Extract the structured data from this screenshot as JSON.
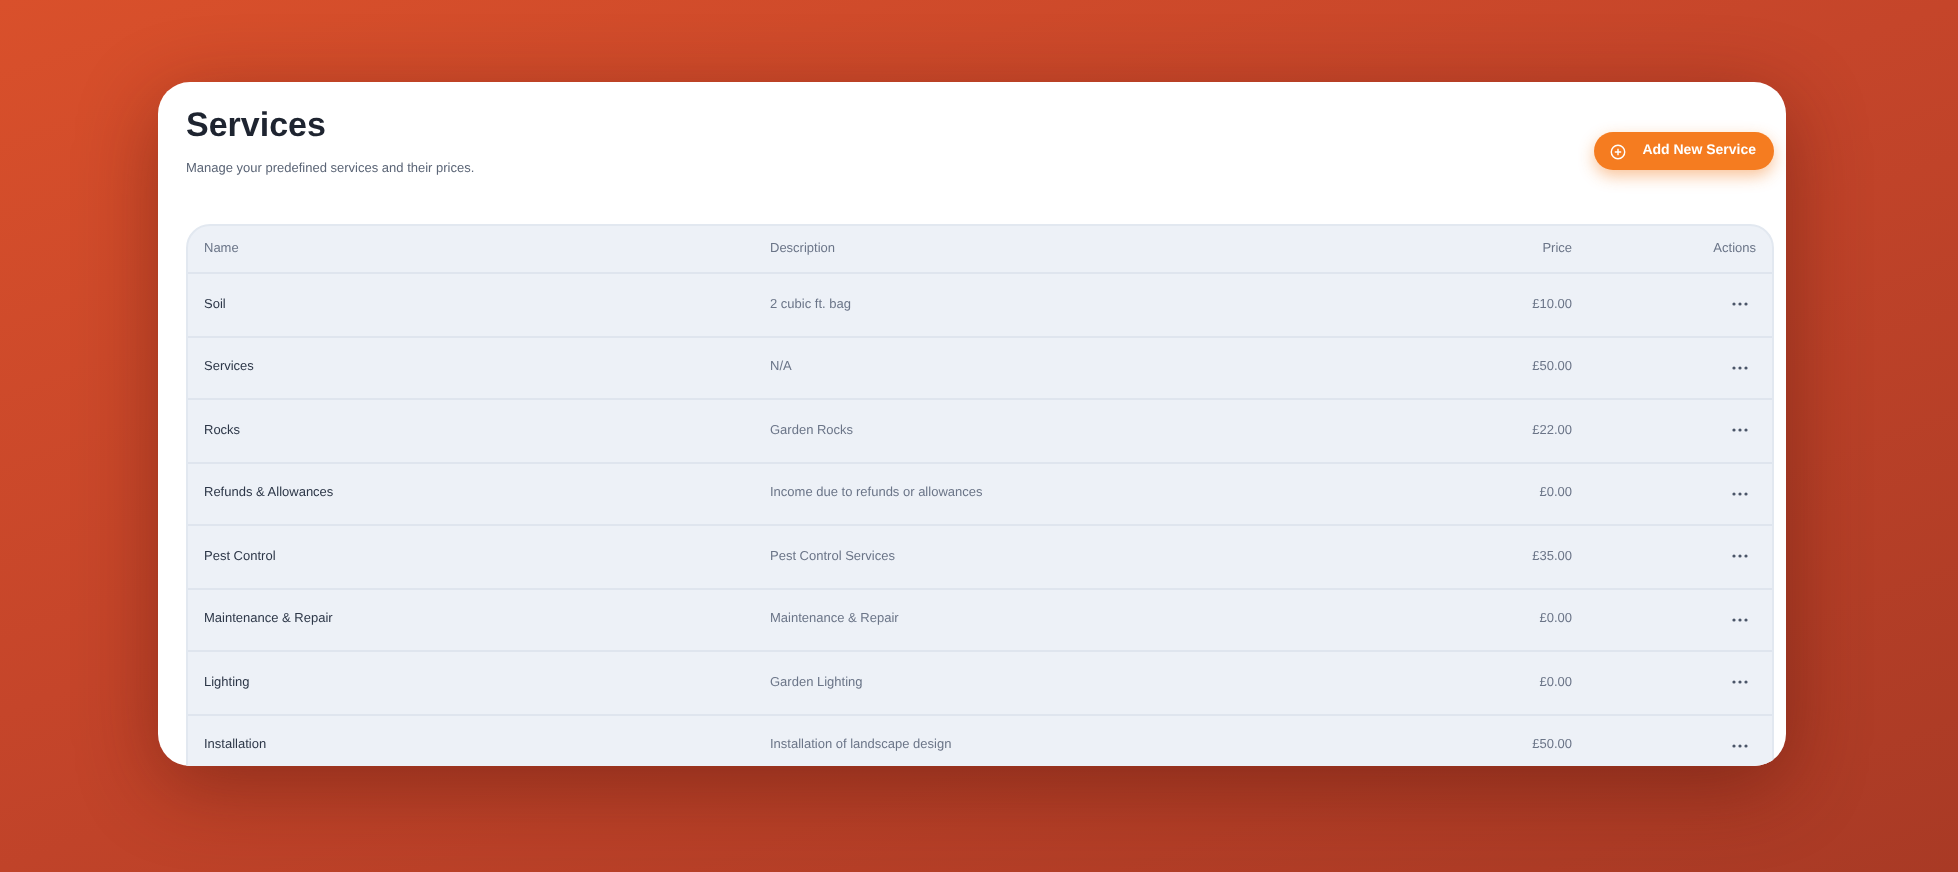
{
  "header": {
    "title": "Services",
    "subtitle": "Manage your predefined services and their prices.",
    "add_button": "Add New Service"
  },
  "table": {
    "columns": [
      "Name",
      "Description",
      "Price",
      "Actions"
    ],
    "rows": [
      {
        "name": "Soil",
        "description": "2 cubic ft. bag",
        "price": "£10.00"
      },
      {
        "name": "Services",
        "description": "N/A",
        "price": "£50.00"
      },
      {
        "name": "Rocks",
        "description": "Garden Rocks",
        "price": "£22.00"
      },
      {
        "name": "Refunds & Allowances",
        "description": "Income due to refunds or allowances",
        "price": "£0.00"
      },
      {
        "name": "Pest Control",
        "description": "Pest Control Services",
        "price": "£35.00"
      },
      {
        "name": "Maintenance & Repair",
        "description": "Maintenance & Repair",
        "price": "£0.00"
      },
      {
        "name": "Lighting",
        "description": "Garden Lighting",
        "price": "£0.00"
      },
      {
        "name": "Installation",
        "description": "Installation of landscape design",
        "price": "£50.00"
      }
    ]
  }
}
